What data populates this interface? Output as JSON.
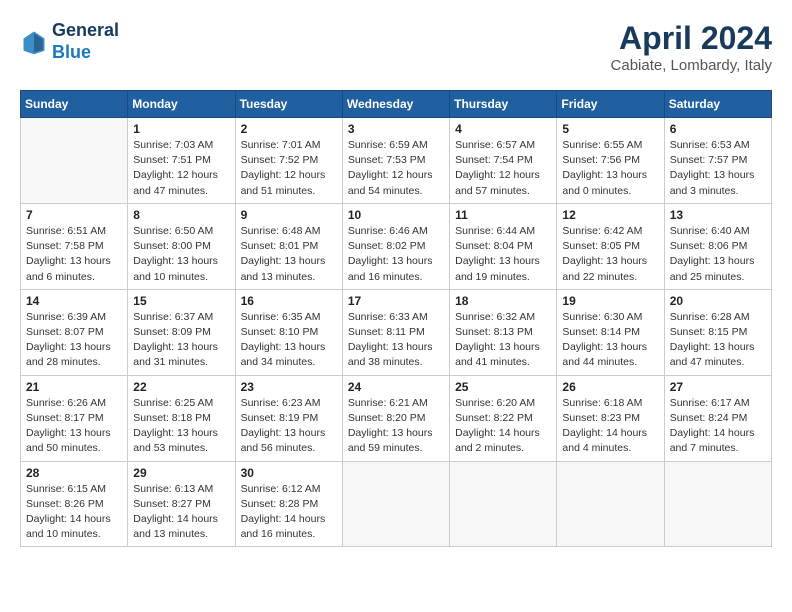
{
  "logo": {
    "line1": "General",
    "line2": "Blue"
  },
  "title": "April 2024",
  "location": "Cabiate, Lombardy, Italy",
  "weekdays": [
    "Sunday",
    "Monday",
    "Tuesday",
    "Wednesday",
    "Thursday",
    "Friday",
    "Saturday"
  ],
  "weeks": [
    [
      {
        "day": "",
        "info": ""
      },
      {
        "day": "1",
        "info": "Sunrise: 7:03 AM\nSunset: 7:51 PM\nDaylight: 12 hours\nand 47 minutes."
      },
      {
        "day": "2",
        "info": "Sunrise: 7:01 AM\nSunset: 7:52 PM\nDaylight: 12 hours\nand 51 minutes."
      },
      {
        "day": "3",
        "info": "Sunrise: 6:59 AM\nSunset: 7:53 PM\nDaylight: 12 hours\nand 54 minutes."
      },
      {
        "day": "4",
        "info": "Sunrise: 6:57 AM\nSunset: 7:54 PM\nDaylight: 12 hours\nand 57 minutes."
      },
      {
        "day": "5",
        "info": "Sunrise: 6:55 AM\nSunset: 7:56 PM\nDaylight: 13 hours\nand 0 minutes."
      },
      {
        "day": "6",
        "info": "Sunrise: 6:53 AM\nSunset: 7:57 PM\nDaylight: 13 hours\nand 3 minutes."
      }
    ],
    [
      {
        "day": "7",
        "info": "Sunrise: 6:51 AM\nSunset: 7:58 PM\nDaylight: 13 hours\nand 6 minutes."
      },
      {
        "day": "8",
        "info": "Sunrise: 6:50 AM\nSunset: 8:00 PM\nDaylight: 13 hours\nand 10 minutes."
      },
      {
        "day": "9",
        "info": "Sunrise: 6:48 AM\nSunset: 8:01 PM\nDaylight: 13 hours\nand 13 minutes."
      },
      {
        "day": "10",
        "info": "Sunrise: 6:46 AM\nSunset: 8:02 PM\nDaylight: 13 hours\nand 16 minutes."
      },
      {
        "day": "11",
        "info": "Sunrise: 6:44 AM\nSunset: 8:04 PM\nDaylight: 13 hours\nand 19 minutes."
      },
      {
        "day": "12",
        "info": "Sunrise: 6:42 AM\nSunset: 8:05 PM\nDaylight: 13 hours\nand 22 minutes."
      },
      {
        "day": "13",
        "info": "Sunrise: 6:40 AM\nSunset: 8:06 PM\nDaylight: 13 hours\nand 25 minutes."
      }
    ],
    [
      {
        "day": "14",
        "info": "Sunrise: 6:39 AM\nSunset: 8:07 PM\nDaylight: 13 hours\nand 28 minutes."
      },
      {
        "day": "15",
        "info": "Sunrise: 6:37 AM\nSunset: 8:09 PM\nDaylight: 13 hours\nand 31 minutes."
      },
      {
        "day": "16",
        "info": "Sunrise: 6:35 AM\nSunset: 8:10 PM\nDaylight: 13 hours\nand 34 minutes."
      },
      {
        "day": "17",
        "info": "Sunrise: 6:33 AM\nSunset: 8:11 PM\nDaylight: 13 hours\nand 38 minutes."
      },
      {
        "day": "18",
        "info": "Sunrise: 6:32 AM\nSunset: 8:13 PM\nDaylight: 13 hours\nand 41 minutes."
      },
      {
        "day": "19",
        "info": "Sunrise: 6:30 AM\nSunset: 8:14 PM\nDaylight: 13 hours\nand 44 minutes."
      },
      {
        "day": "20",
        "info": "Sunrise: 6:28 AM\nSunset: 8:15 PM\nDaylight: 13 hours\nand 47 minutes."
      }
    ],
    [
      {
        "day": "21",
        "info": "Sunrise: 6:26 AM\nSunset: 8:17 PM\nDaylight: 13 hours\nand 50 minutes."
      },
      {
        "day": "22",
        "info": "Sunrise: 6:25 AM\nSunset: 8:18 PM\nDaylight: 13 hours\nand 53 minutes."
      },
      {
        "day": "23",
        "info": "Sunrise: 6:23 AM\nSunset: 8:19 PM\nDaylight: 13 hours\nand 56 minutes."
      },
      {
        "day": "24",
        "info": "Sunrise: 6:21 AM\nSunset: 8:20 PM\nDaylight: 13 hours\nand 59 minutes."
      },
      {
        "day": "25",
        "info": "Sunrise: 6:20 AM\nSunset: 8:22 PM\nDaylight: 14 hours\nand 2 minutes."
      },
      {
        "day": "26",
        "info": "Sunrise: 6:18 AM\nSunset: 8:23 PM\nDaylight: 14 hours\nand 4 minutes."
      },
      {
        "day": "27",
        "info": "Sunrise: 6:17 AM\nSunset: 8:24 PM\nDaylight: 14 hours\nand 7 minutes."
      }
    ],
    [
      {
        "day": "28",
        "info": "Sunrise: 6:15 AM\nSunset: 8:26 PM\nDaylight: 14 hours\nand 10 minutes."
      },
      {
        "day": "29",
        "info": "Sunrise: 6:13 AM\nSunset: 8:27 PM\nDaylight: 14 hours\nand 13 minutes."
      },
      {
        "day": "30",
        "info": "Sunrise: 6:12 AM\nSunset: 8:28 PM\nDaylight: 14 hours\nand 16 minutes."
      },
      {
        "day": "",
        "info": ""
      },
      {
        "day": "",
        "info": ""
      },
      {
        "day": "",
        "info": ""
      },
      {
        "day": "",
        "info": ""
      }
    ]
  ]
}
